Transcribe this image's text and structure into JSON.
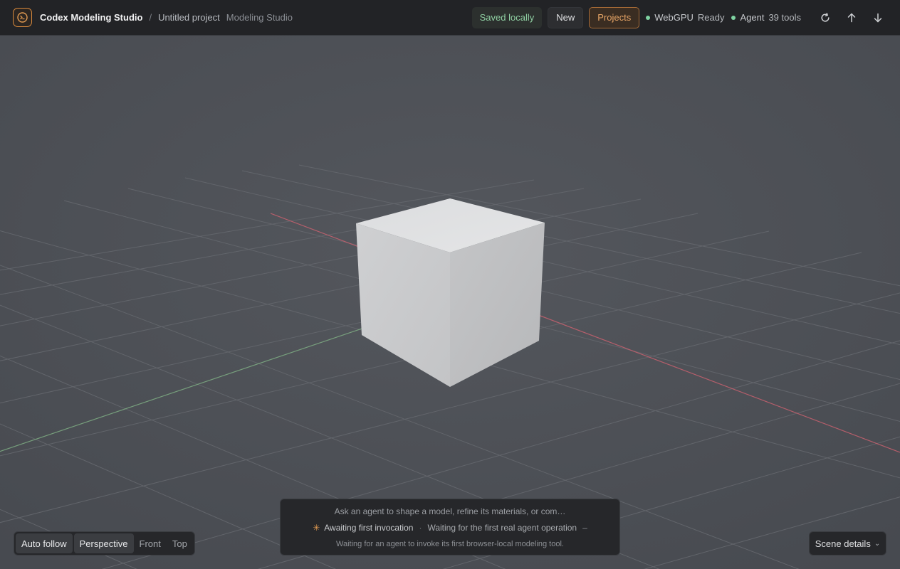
{
  "header": {
    "app_title": "Codex Modeling Studio",
    "breadcrumb_separator": "/",
    "project_name": "Untitled project",
    "studio_label": "Modeling Studio",
    "save_status": "Saved locally",
    "new_label": "New",
    "projects_label": "Projects",
    "webgpu": {
      "label": "WebGPU",
      "state": "Ready"
    },
    "agent": {
      "label": "Agent",
      "tools": "39 tools"
    },
    "icons": [
      "refresh-icon",
      "arrow-up-icon",
      "arrow-down-icon"
    ]
  },
  "viewbar": {
    "auto_follow": "Auto follow",
    "perspective": "Perspective",
    "front": "Front",
    "top": "Top",
    "active": [
      "Auto follow",
      "Perspective"
    ]
  },
  "prompt": {
    "placeholder": "Ask an agent to shape a model, refine its materials, or com…",
    "status_title": "Awaiting first invocation",
    "status_detail": "Waiting for the first real agent operation",
    "status_dash": "–",
    "detail": "Waiting for an agent to invoke its first browser-local modeling tool."
  },
  "scene_details": {
    "label": "Scene details"
  },
  "colors": {
    "accent": "#d98a3d",
    "ready": "#7fd3a2",
    "viewport_bg": "#4d5056",
    "x_axis": "#c8616f",
    "z_axis": "#7fae84"
  }
}
